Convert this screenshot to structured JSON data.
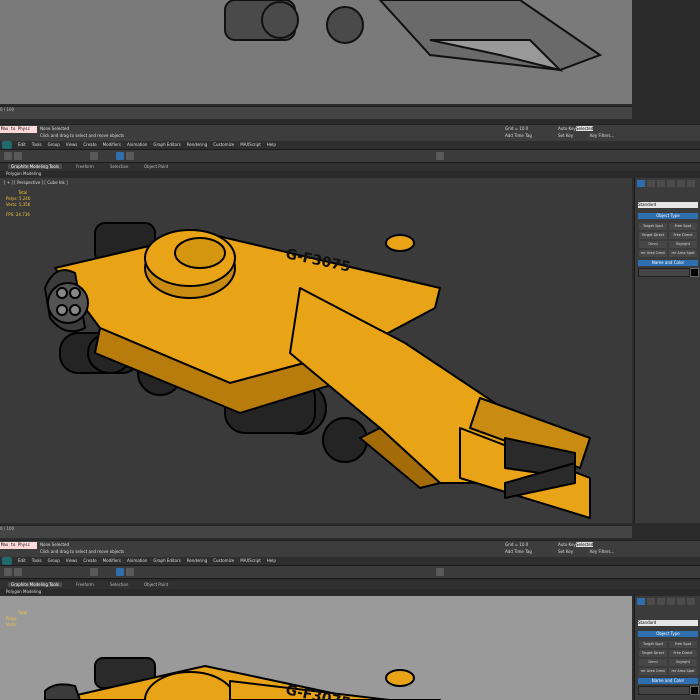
{
  "status": {
    "none_selected": "None Selected",
    "prompt": "Click and drag to select and move objects",
    "grid": "Grid = 10.0",
    "add_time_tag": "Add Time Tag",
    "auto_key": "Auto Key",
    "set_key": "Set Key",
    "selected": "Selected",
    "key_filters": "Key Filters...",
    "maxscript_cmd": "Max to Physc"
  },
  "timeline": {
    "frames": "0 / 100"
  },
  "menu": [
    "Edit",
    "Tools",
    "Group",
    "Views",
    "Create",
    "Modifiers",
    "Animation",
    "Graph Editors",
    "Rendering",
    "Customize",
    "MAXScript",
    "Help"
  ],
  "ribbon": {
    "tabs": [
      "Graphite Modeling Tools",
      "Freeform",
      "Selection",
      "Object Paint"
    ],
    "polygon_modeling": "Polygon Modeling"
  },
  "viewport": {
    "label": "[ + ] [ Perspective ] [ Cube Ink ]",
    "stats": {
      "total": "Total",
      "polys": "Polys:",
      "polys_val": "5,240",
      "verts": "Verts:",
      "verts_val": "5,356",
      "fps": "FPS:",
      "fps_val": "24.736"
    },
    "ship_decal": "G-F3075"
  },
  "command_panel": {
    "dropdown": "Standard",
    "object_type": "Object Type",
    "buttons": [
      "Target Spot",
      "Free Spot",
      "Target Direct",
      "Free Direct",
      "Omni",
      "Skylight",
      "mr Area Omni",
      "mr Area Spot"
    ],
    "name_and_color": "Name and Color"
  },
  "colors": {
    "ship_yellow": "#e8a317",
    "ship_dark": "#2a2a2a",
    "viewport_dark": "#3a3a3a",
    "viewport_light": "#9a9a9a",
    "accent_blue": "#2f6fb0"
  }
}
